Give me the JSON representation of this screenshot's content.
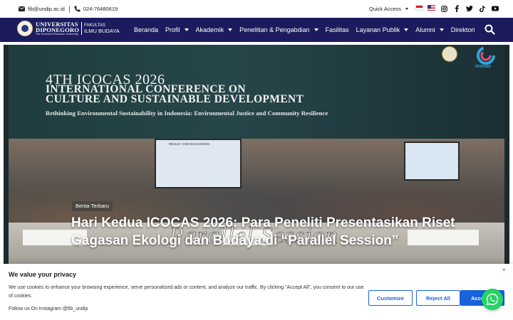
{
  "topbar": {
    "email": "fib@undip.ac.id",
    "phone": "024-76480619",
    "quick_access": "Quick Access",
    "flags": [
      "id-flag-icon",
      "us-flag-icon"
    ],
    "social": [
      "instagram-icon",
      "facebook-icon",
      "twitter-icon",
      "tiktok-icon",
      "youtube-icon"
    ]
  },
  "logo": {
    "university_line1": "UNIVERSITAS",
    "university_line2": "DIPONEGORO",
    "tagline": "The Excellent Research University",
    "faculty_line1": "FAKULTAS",
    "faculty_line2": "ILMU BUDAYA"
  },
  "nav": {
    "items": [
      {
        "label": "Beranda",
        "dropdown": false
      },
      {
        "label": "Profil",
        "dropdown": true
      },
      {
        "label": "Akademik",
        "dropdown": true
      },
      {
        "label": "Penelitian & Pengabdian",
        "dropdown": true
      },
      {
        "label": "Fasilitas",
        "dropdown": false
      },
      {
        "label": "Layanan Publik",
        "dropdown": true
      },
      {
        "label": "Alumni",
        "dropdown": true
      },
      {
        "label": "Direktori",
        "dropdown": false
      }
    ]
  },
  "hero": {
    "banner_line1": "4TH ICOCAS 2026",
    "banner_line2a": "INTERNATIONAL CONFERENCE ON",
    "banner_line2b": "CULTURE AND SUSTAINABLE DEVELOPMENT",
    "banner_line3": "Rethinking Environmental Sustainability in Indonesia: Environmental Justice and Community Resilience",
    "screen_text": "RESULT AND DISCUSSION",
    "logo2_text": "icocas",
    "watermark": "Parallel Session",
    "category": "Berita Terbaru",
    "headline": "Hari Kedua ICOCAS 2026: Para Peneliti Presentasikan Riset Gagasan Ekologi dan Budaya di “Parallel Session”"
  },
  "cookie": {
    "title": "We value your privacy",
    "message": "We use cookies to enhance your browsing experience, serve personalized ads or content, and analyze our traffic. By clicking \"Accept All\", you consent to our use of cookies.",
    "follow": "Follow us On Instagram @fib_undip",
    "customize": "Customize",
    "reject": "Reject All",
    "accept": "Acce",
    "close": "×"
  },
  "colors": {
    "nav_bg": "#1b1b5e",
    "button_blue": "#1863dc",
    "whatsapp_green": "#25d366"
  }
}
